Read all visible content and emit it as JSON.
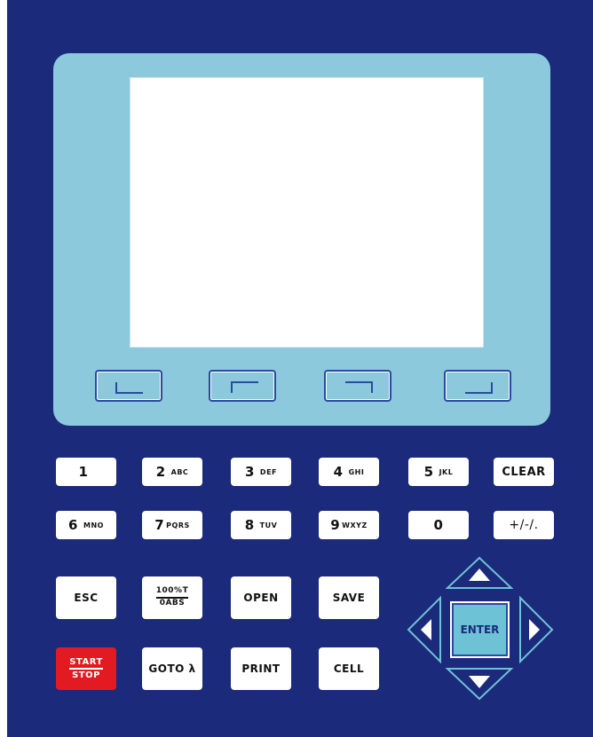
{
  "keypad": {
    "row1": [
      {
        "digit": "1",
        "letters": ""
      },
      {
        "digit": "2",
        "letters": "ABC"
      },
      {
        "digit": "3",
        "letters": "DEF"
      },
      {
        "digit": "4",
        "letters": "GHI"
      },
      {
        "digit": "5",
        "letters": "JKL"
      },
      {
        "label": "CLEAR"
      }
    ],
    "row2": [
      {
        "digit": "6",
        "letters": "MNO"
      },
      {
        "digit": "7",
        "letters": "PQRS"
      },
      {
        "digit": "8",
        "letters": "TUV"
      },
      {
        "digit": "9",
        "letters": "WXYZ"
      },
      {
        "digit": "0",
        "letters": ""
      },
      {
        "label": "+/-/."
      }
    ]
  },
  "function_keys": {
    "esc": "ESC",
    "mode_top": "100%T",
    "mode_bottom": "0ABS",
    "open": "OPEN",
    "save": "SAVE",
    "start": "START",
    "stop": "STOP",
    "goto": "GOTO λ",
    "print": "PRINT",
    "cell": "CELL"
  },
  "navigation": {
    "enter": "ENTER",
    "icons": [
      "arrow-up-icon",
      "arrow-down-icon",
      "arrow-left-icon",
      "arrow-right-icon"
    ]
  },
  "softkeys": [
    "corner-bottom-left-icon",
    "corner-top-left-icon",
    "corner-top-right-icon",
    "corner-bottom-right-icon"
  ],
  "colors": {
    "panel": "#1b2a7a",
    "bezel": "#8cc9dc",
    "start_stop": "#e21b23",
    "enter": "#6ec2d6"
  }
}
